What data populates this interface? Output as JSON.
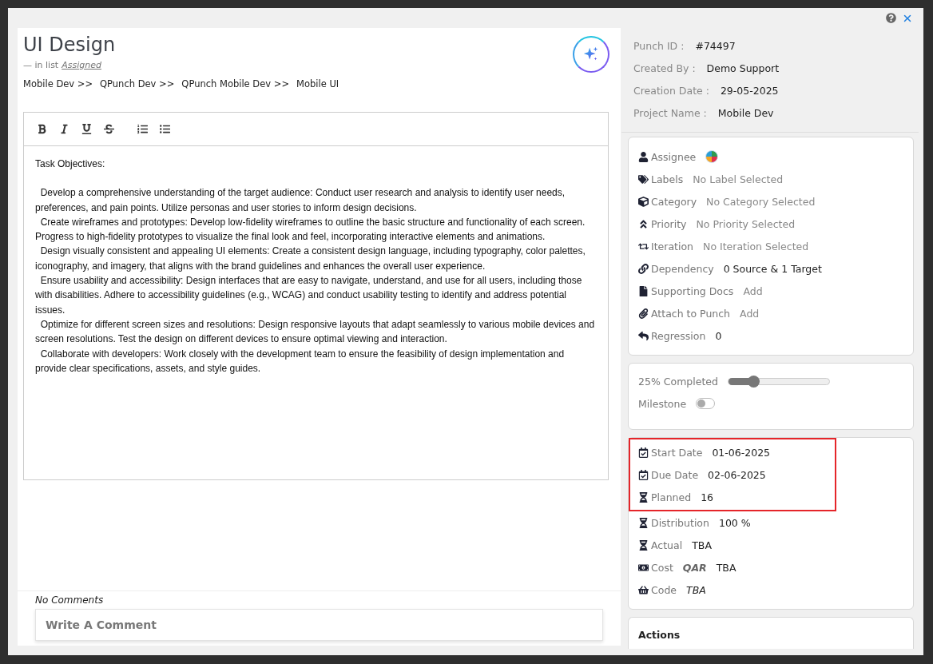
{
  "task": {
    "title": "UI Design",
    "list_prefix": "—  in list",
    "list_name": "Assigned",
    "breadcrumb": [
      "Mobile Dev >>",
      "QPunch Dev >>",
      "QPunch Mobile Dev >>",
      "Mobile UI"
    ]
  },
  "toolbar": [
    {
      "kind": "bold"
    },
    {
      "kind": "italic"
    },
    {
      "kind": "underline"
    },
    {
      "kind": "strike"
    },
    {
      "kind": "ordered"
    },
    {
      "kind": "bullet"
    }
  ],
  "description": [
    "Task Objectives:",
    "  Develop a comprehensive understanding of the target audience: Conduct user research and analysis to identify user needs, preferences, and pain points. Utilize personas and user stories to inform design decisions.",
    "  Create wireframes and prototypes: Develop low-fidelity wireframes to outline the basic structure and functionality of each screen. Progress to high-fidelity prototypes to visualize the final look and feel, incorporating interactive elements and animations.",
    "  Design visually consistent and appealing UI elements: Create a consistent design language, including typography, color palettes, iconography, and imagery, that aligns with the brand guidelines and enhances the overall user experience.",
    "  Ensure usability and accessibility: Design interfaces that are easy to navigate, understand, and use for all users, including those with disabilities. Adhere to accessibility guidelines (e.g., WCAG) and conduct usability testing to identify and address potential issues.",
    "  Optimize for different screen sizes and resolutions: Design responsive layouts that adapt seamlessly to various mobile devices and screen resolutions. Test the design on different devices to ensure optimal viewing and interaction.",
    "  Collaborate with developers: Work closely with the development team to ensure the feasibility of design implementation and provide clear specifications, assets, and style guides."
  ],
  "comments": {
    "empty_text": "No Comments",
    "placeholder": "Write A Comment"
  },
  "meta": [
    {
      "label": "Punch ID :",
      "value": "#74497"
    },
    {
      "label": "Created By :",
      "value": "Demo Support"
    },
    {
      "label": "Creation Date :",
      "value": "29-05-2025"
    },
    {
      "label": "Project Name :",
      "value": "Mobile Dev"
    }
  ],
  "details": [
    {
      "kind": "user",
      "label": "Assignee",
      "avatar": true
    },
    {
      "kind": "tag",
      "label": "Labels",
      "placeholder": "No Label Selected"
    },
    {
      "kind": "cube",
      "label": "Category",
      "placeholder": "No Category Selected"
    },
    {
      "kind": "priority",
      "label": "Priority",
      "placeholder": "No Priority Selected"
    },
    {
      "kind": "iteration",
      "label": "Iteration",
      "placeholder": "No Iteration Selected"
    },
    {
      "kind": "link",
      "label": "Dependency",
      "value": "0 Source & 1 Target"
    },
    {
      "kind": "file",
      "label": "Supporting Docs",
      "placeholder": "Add"
    },
    {
      "kind": "paperclip",
      "label": "Attach to Punch",
      "placeholder": "Add"
    },
    {
      "kind": "reply",
      "label": "Regression",
      "value": "0"
    }
  ],
  "progress": {
    "label": "25% Completed",
    "level": 0.25
  },
  "milestone": {
    "label": "Milestone",
    "on": false
  },
  "schedule": {
    "highlighted_rows": [
      {
        "kind": "calendar",
        "label": "Start Date",
        "value": "01-06-2025"
      },
      {
        "kind": "calendar",
        "label": "Due Date",
        "value": "02-06-2025"
      },
      {
        "kind": "hourglass",
        "label": "Planned",
        "value": "16"
      }
    ],
    "rows": [
      {
        "kind": "hourglass",
        "label": "Distribution",
        "value": "100 %"
      },
      {
        "kind": "hourglass",
        "label": "Actual",
        "value": "TBA"
      },
      {
        "kind": "money",
        "label": "Cost",
        "currency": "QAR",
        "value": "TBA"
      },
      {
        "kind": "basket",
        "label": "Code",
        "value": "TBA",
        "italic": true
      }
    ]
  },
  "actions": {
    "title": "Actions"
  }
}
